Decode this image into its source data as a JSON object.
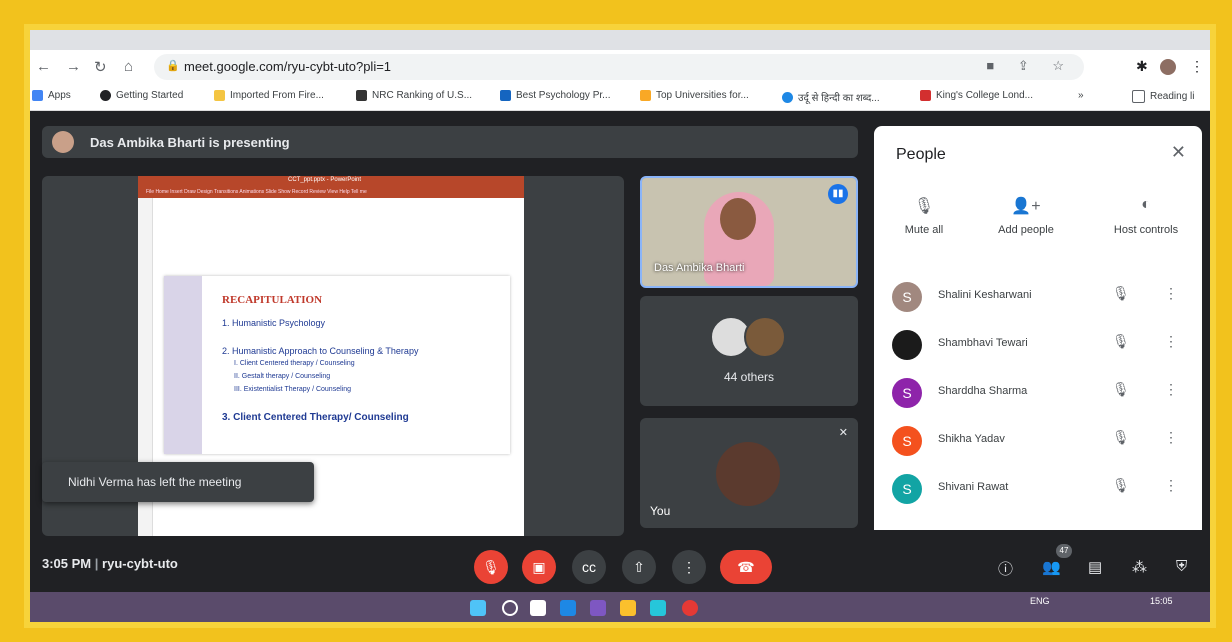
{
  "browser": {
    "url": "meet.google.com/ryu-cybt-uto?pli=1",
    "bookmarks": [
      "Apps",
      "Getting Started",
      "Imported From Fire...",
      "NRC Ranking of U.S...",
      "Best Psychology Pr...",
      "Top Universities for...",
      "उर्दू से हिन्दी का शब्द...",
      "King's College Lond..."
    ],
    "more_bookmarks": "»",
    "reading_list": "Reading li"
  },
  "meet": {
    "presenting_text": "Das Ambika Bharti is presenting",
    "toast": "Nidhi Verma has left the meeting",
    "tiles": {
      "speaker_name": "Das Ambika Bharti",
      "others_label": "44 others",
      "self_label": "You"
    },
    "time": "3:05 PM",
    "separator": "|",
    "meeting_code": "ryu-cybt-uto",
    "participant_count": "47"
  },
  "slide": {
    "app_title": "CCT_ppt.pptx - PowerPoint",
    "ribbon": "File  Home  Insert  Draw  Design  Transitions  Animations  Slide Show  Record  Review  View  Help  Tell me",
    "title": "RECAPITULATION",
    "items": [
      "1.  Humanistic Psychology",
      "2.  Humanistic Approach to Counseling & Therapy",
      "3.  Client Centered Therapy/ Counseling"
    ],
    "subitems": [
      "I.    Client Centered therapy / Counseling",
      "II.   Gestalt therapy / Counseling",
      "III.  Existentialist Therapy / Counseling"
    ]
  },
  "people_panel": {
    "title": "People",
    "actions": [
      "Mute all",
      "Add people",
      "Host controls"
    ],
    "participants": [
      {
        "initial": "S",
        "name": "Shalini Kesharwani",
        "color": "#a1887f"
      },
      {
        "initial": "",
        "name": "Shambhavi Tewari",
        "color": "#1b1b1b"
      },
      {
        "initial": "S",
        "name": "Sharddha Sharma",
        "color": "#8e24aa"
      },
      {
        "initial": "S",
        "name": "Shikha Yadav",
        "color": "#f4511e"
      },
      {
        "initial": "S",
        "name": "Shivani Rawat",
        "color": "#12a4a4"
      }
    ]
  },
  "taskbar": {
    "lang": "ENG",
    "time": "15:05"
  },
  "colors": {
    "border": "#f2c21d",
    "meet_bg": "#202124",
    "end_call": "#ea4335",
    "accent": "#1a73e8"
  }
}
